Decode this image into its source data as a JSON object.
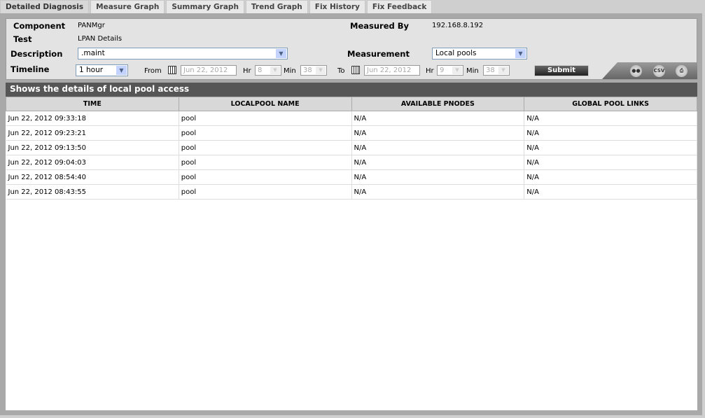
{
  "tabs": [
    "Detailed Diagnosis",
    "Measure Graph",
    "Summary Graph",
    "Trend Graph",
    "Fix History",
    "Fix Feedback"
  ],
  "form": {
    "component_label": "Component",
    "component": "PANMgr",
    "test_label": "Test",
    "test": "LPAN Details",
    "measured_by_label": "Measured By",
    "measured_by": "192.168.8.192",
    "description_label": "Description",
    "description": ".maint",
    "measurement_label": "Measurement",
    "measurement": "Local pools",
    "timeline_label": "Timeline",
    "timeline": "1 hour",
    "from_label": "From",
    "from_date": "Jun 22, 2012",
    "from_hr": "8",
    "from_min": "38",
    "to_label": "To",
    "to_date": "Jun 22, 2012",
    "to_hr": "9",
    "to_min": "38",
    "hr_label": "Hr",
    "min_label": "Min",
    "submit": "Submit",
    "csv": "CSV"
  },
  "section_title": "Shows the details of local pool access",
  "table": {
    "columns": [
      "TIME",
      "LOCALPOOL NAME",
      "AVAILABLE PNODES",
      "GLOBAL POOL LINKS"
    ],
    "rows": [
      [
        "Jun 22, 2012 09:33:18",
        "pool",
        "N/A",
        "N/A"
      ],
      [
        "Jun 22, 2012 09:23:21",
        "pool",
        "N/A",
        "N/A"
      ],
      [
        "Jun 22, 2012 09:13:50",
        "pool",
        "N/A",
        "N/A"
      ],
      [
        "Jun 22, 2012 09:04:03",
        "pool",
        "N/A",
        "N/A"
      ],
      [
        "Jun 22, 2012 08:54:40",
        "pool",
        "N/A",
        "N/A"
      ],
      [
        "Jun 22, 2012 08:43:55",
        "pool",
        "N/A",
        "N/A"
      ]
    ]
  }
}
